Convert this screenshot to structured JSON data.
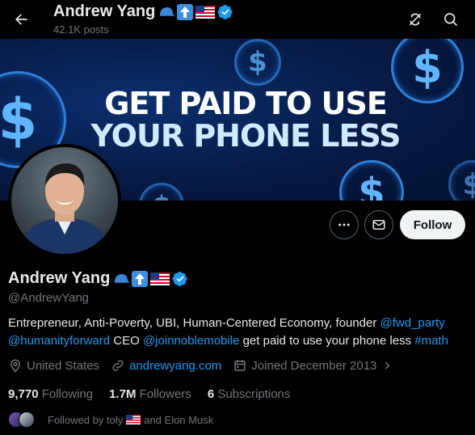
{
  "header": {
    "name": "Andrew Yang",
    "posts_count": "42.1K posts"
  },
  "banner": {
    "line1": "GET PAID TO USE",
    "line2": "YOUR PHONE LESS"
  },
  "profile": {
    "name": "Andrew Yang",
    "handle": "@AndrewYang",
    "bio": {
      "text1": "Entrepreneur, Anti-Poverty, UBI, Human-Centered Economy, founder ",
      "link1": "@fwd_party",
      "link2": "@humanityforward",
      "text2": " CEO ",
      "link3": "@joinnoblemobile",
      "text3": " get paid to use your phone less ",
      "link4": "#math"
    },
    "location": "United States",
    "website": "andrewyang.com",
    "joined": "Joined December 2013"
  },
  "actions": {
    "follow_label": "Follow"
  },
  "stats": {
    "following_count": "9,770",
    "following_label": "Following",
    "followers_count": "1.7M",
    "followers_label": "Followers",
    "subscriptions_count": "6",
    "subscriptions_label": "Subscriptions"
  },
  "followed_by": {
    "prefix": "Followed by toly",
    "suffix": "and Elon Musk"
  },
  "icons": {
    "back": "arrow-left-icon",
    "refresh": "refresh-icon",
    "search": "search-icon",
    "more": "more-icon",
    "message": "envelope-icon",
    "location": "location-pin-icon",
    "link": "link-icon",
    "calendar": "calendar-icon",
    "verified": "verified-badge-icon"
  },
  "colors": {
    "accent": "#1d9bf0",
    "muted": "#71767b",
    "text": "#e7e9ea",
    "background": "#000000"
  }
}
